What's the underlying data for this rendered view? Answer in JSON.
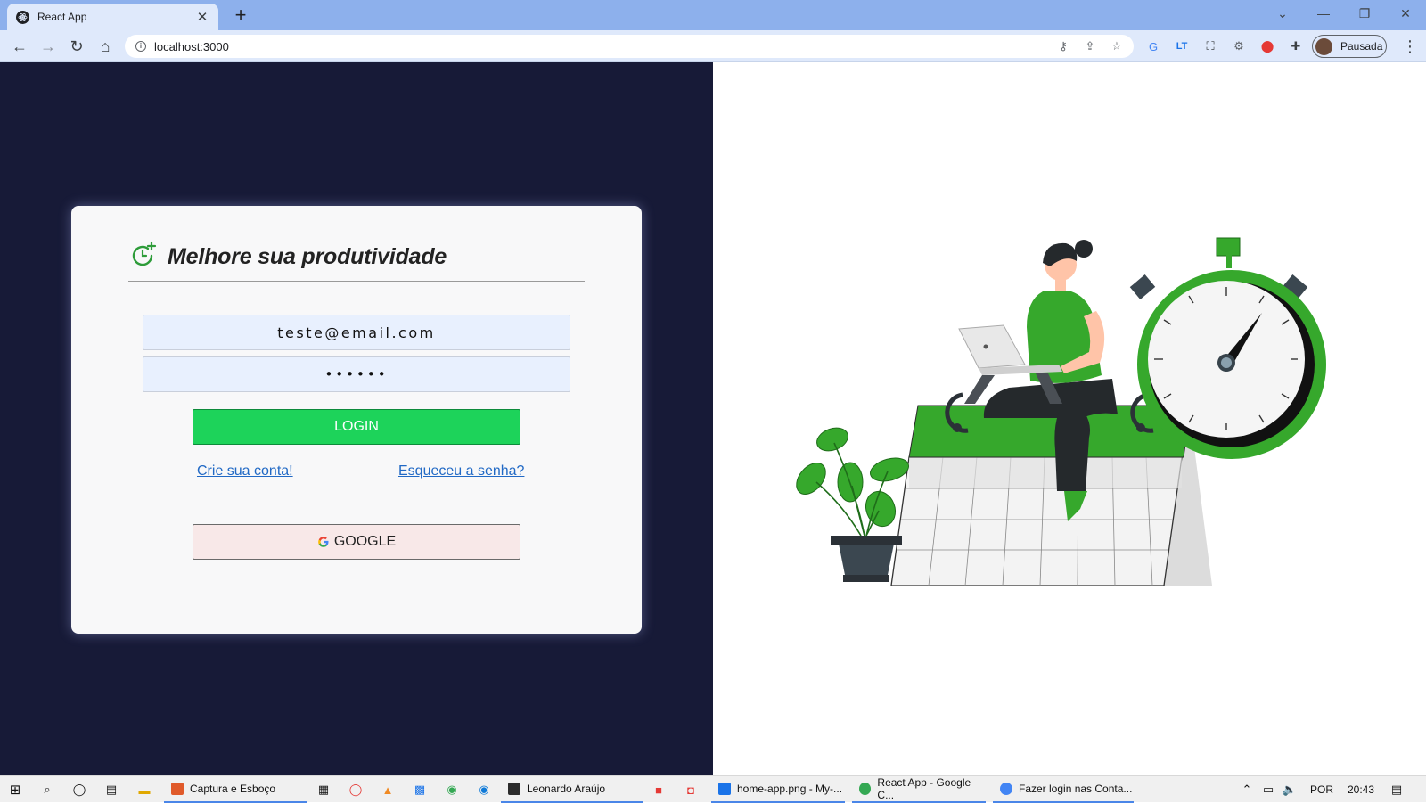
{
  "browser": {
    "tab_title": "React App",
    "url": "localhost:3000",
    "profile_label": "Pausada"
  },
  "card": {
    "title": "Melhore sua produtividade",
    "email_value": "teste@email.com",
    "password_value": "••••••",
    "login_label": "LOGIN",
    "create_account_link": "Crie sua conta!",
    "forgot_password_link": "Esqueceu a senha?",
    "google_label": "GOOGLE",
    "accent_color": "#1dd35a"
  },
  "taskbar": {
    "apps": [
      {
        "label": "Captura e Esboço"
      },
      {
        "label": "Leonardo Araújo"
      },
      {
        "label": "home-app.png - My-..."
      },
      {
        "label": "React App - Google C..."
      },
      {
        "label": "Fazer login nas Conta..."
      }
    ],
    "language": "POR",
    "time": "20:43"
  }
}
